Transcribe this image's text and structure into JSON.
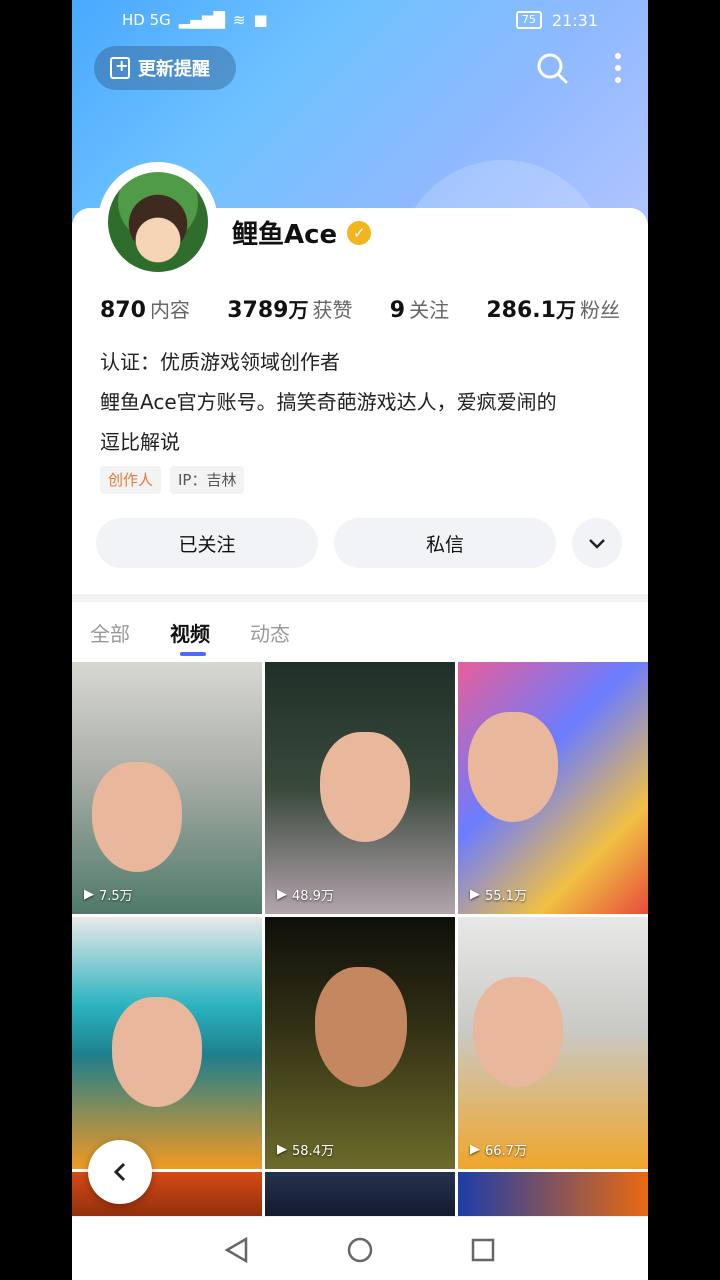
{
  "status_bar": {
    "network": "HD 5G",
    "battery": "75",
    "time": "21:31"
  },
  "header": {
    "update_reminder_label": "更新提醒"
  },
  "profile": {
    "name": "鲤鱼Ace",
    "stats": [
      {
        "num": "870",
        "unit": "",
        "label": "内容"
      },
      {
        "num": "3789",
        "unit": "万",
        "label": "获赞"
      },
      {
        "num": "9",
        "unit": "",
        "label": "关注"
      },
      {
        "num": "286.1",
        "unit": "万",
        "label": "粉丝"
      }
    ],
    "certification": "认证：优质游戏领域创作者",
    "bio_line1": "鲤鱼Ace官方账号。搞笑奇葩游戏达人，爱疯爱闹的",
    "bio_line2": "逗比解说",
    "tag_creator": "创作人",
    "tag_ip": "IP：吉林"
  },
  "actions": {
    "follow_label": "已关注",
    "message_label": "私信"
  },
  "tabs": [
    {
      "label": "全部"
    },
    {
      "label": "视频"
    },
    {
      "label": "动态"
    }
  ],
  "videos": [
    {
      "views": "7.5万"
    },
    {
      "views": "48.9万"
    },
    {
      "views": "55.1万"
    },
    {
      "views": ""
    },
    {
      "views": "58.4万"
    },
    {
      "views": "66.7万"
    }
  ]
}
